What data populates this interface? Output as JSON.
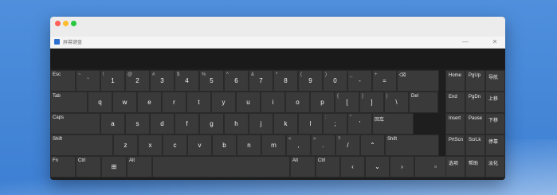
{
  "window": {
    "title": "屏幕键盘",
    "minimize": "—",
    "close": "✕",
    "traffic_lights": [
      "#ff5f57",
      "#febc2e",
      "#28c840"
    ]
  },
  "keyboard": {
    "row1": [
      {
        "label": "Esc"
      },
      {
        "shift": "~",
        "main": "`"
      },
      {
        "shift": "!",
        "main": "1"
      },
      {
        "shift": "@",
        "main": "2"
      },
      {
        "shift": "#",
        "main": "3"
      },
      {
        "shift": "$",
        "main": "4"
      },
      {
        "shift": "%",
        "main": "5"
      },
      {
        "shift": "^",
        "main": "6"
      },
      {
        "shift": "&",
        "main": "7"
      },
      {
        "shift": "*",
        "main": "8"
      },
      {
        "shift": "(",
        "main": "9"
      },
      {
        "shift": ")",
        "main": "0"
      },
      {
        "shift": "_",
        "main": "-"
      },
      {
        "shift": "+",
        "main": "="
      },
      {
        "label": "⌫"
      }
    ],
    "row2": [
      {
        "label": "Tab"
      },
      {
        "main": "q"
      },
      {
        "main": "w"
      },
      {
        "main": "e"
      },
      {
        "main": "r"
      },
      {
        "main": "t"
      },
      {
        "main": "y"
      },
      {
        "main": "u"
      },
      {
        "main": "i"
      },
      {
        "main": "o"
      },
      {
        "main": "p"
      },
      {
        "shift": "{",
        "main": "["
      },
      {
        "shift": "}",
        "main": "]"
      },
      {
        "shift": "|",
        "main": "\\"
      },
      {
        "label": "Del"
      }
    ],
    "row3": [
      {
        "label": "Caps"
      },
      {
        "main": "a"
      },
      {
        "main": "s"
      },
      {
        "main": "d"
      },
      {
        "main": "f"
      },
      {
        "main": "g"
      },
      {
        "main": "h"
      },
      {
        "main": "j"
      },
      {
        "main": "k"
      },
      {
        "main": "l"
      },
      {
        "shift": ":",
        "main": ";"
      },
      {
        "shift": "\"",
        "main": "'"
      },
      {
        "label": "回车"
      }
    ],
    "row4": [
      {
        "label": "Shift"
      },
      {
        "main": "z"
      },
      {
        "main": "x"
      },
      {
        "main": "c"
      },
      {
        "main": "v"
      },
      {
        "main": "b"
      },
      {
        "main": "n"
      },
      {
        "main": "m"
      },
      {
        "shift": "<",
        "main": ","
      },
      {
        "shift": ">",
        "main": "."
      },
      {
        "shift": "?",
        "main": "/"
      },
      {
        "main": "⌃"
      },
      {
        "label": "Shift"
      }
    ],
    "row5": [
      {
        "label": "Fn"
      },
      {
        "label": "Ctrl"
      },
      {
        "main": "⊞"
      },
      {
        "label": "Alt"
      },
      {
        "label": ""
      },
      {
        "label": "Alt"
      },
      {
        "label": "Ctrl"
      },
      {
        "main": "‹"
      },
      {
        "main": "⌄"
      },
      {
        "main": "›"
      },
      {
        "main": "▫"
      }
    ],
    "nav": [
      [
        "Home",
        "PgUp",
        "导航"
      ],
      [
        "End",
        "PgDn",
        "上移"
      ],
      [
        "Insert",
        "Pause",
        "下移"
      ],
      [
        "PrtScn",
        "ScrLk",
        "停靠"
      ],
      [
        "选项",
        "帮助",
        "淡化"
      ]
    ]
  }
}
